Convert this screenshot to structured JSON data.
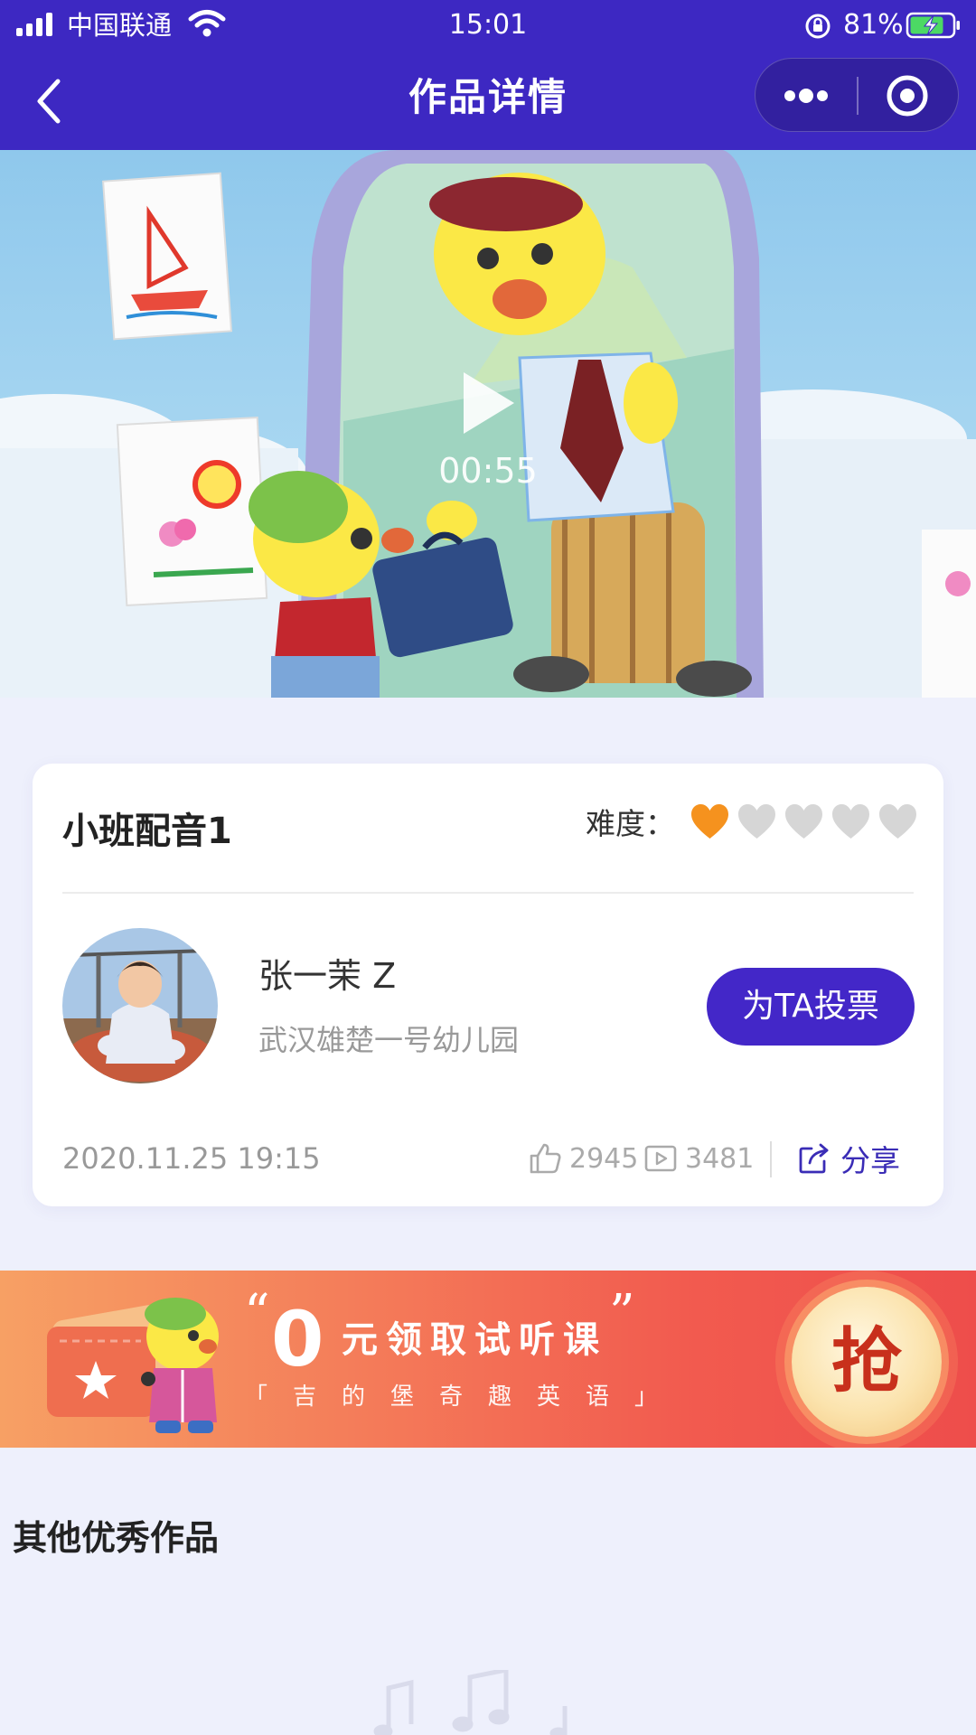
{
  "status_bar": {
    "carrier": "中国联通",
    "time": "15:01",
    "battery": "81%"
  },
  "nav": {
    "title": "作品详情",
    "back_icon": "chevron-left-icon",
    "more_icon": "more-dots-icon",
    "close_icon": "target-circle-icon"
  },
  "video": {
    "duration": "00:55",
    "play_icon": "play-icon"
  },
  "work": {
    "title": "小班配音1",
    "difficulty_label": "难度：",
    "difficulty_level": 1,
    "difficulty_max": 5,
    "author_name": "张一茉 Z",
    "school": "武汉雄楚一号幼儿园",
    "vote_label": "为TA投票",
    "date": "2020.11.25 19:15",
    "likes": "2945",
    "plays": "3481",
    "share_label": "分享"
  },
  "banner": {
    "quote_open": "“",
    "zero": "0",
    "main_text": "元领取试听课",
    "quote_close": "”",
    "sub_text": "「吉的堡奇趣英语」",
    "grab_label": "抢"
  },
  "other": {
    "section_title": "其他优秀作品"
  },
  "colors": {
    "primary": "#3d28c2",
    "accent_heart": "#f5921e",
    "inactive_heart": "#d6d6d6",
    "page_bg": "#eef0fc"
  }
}
